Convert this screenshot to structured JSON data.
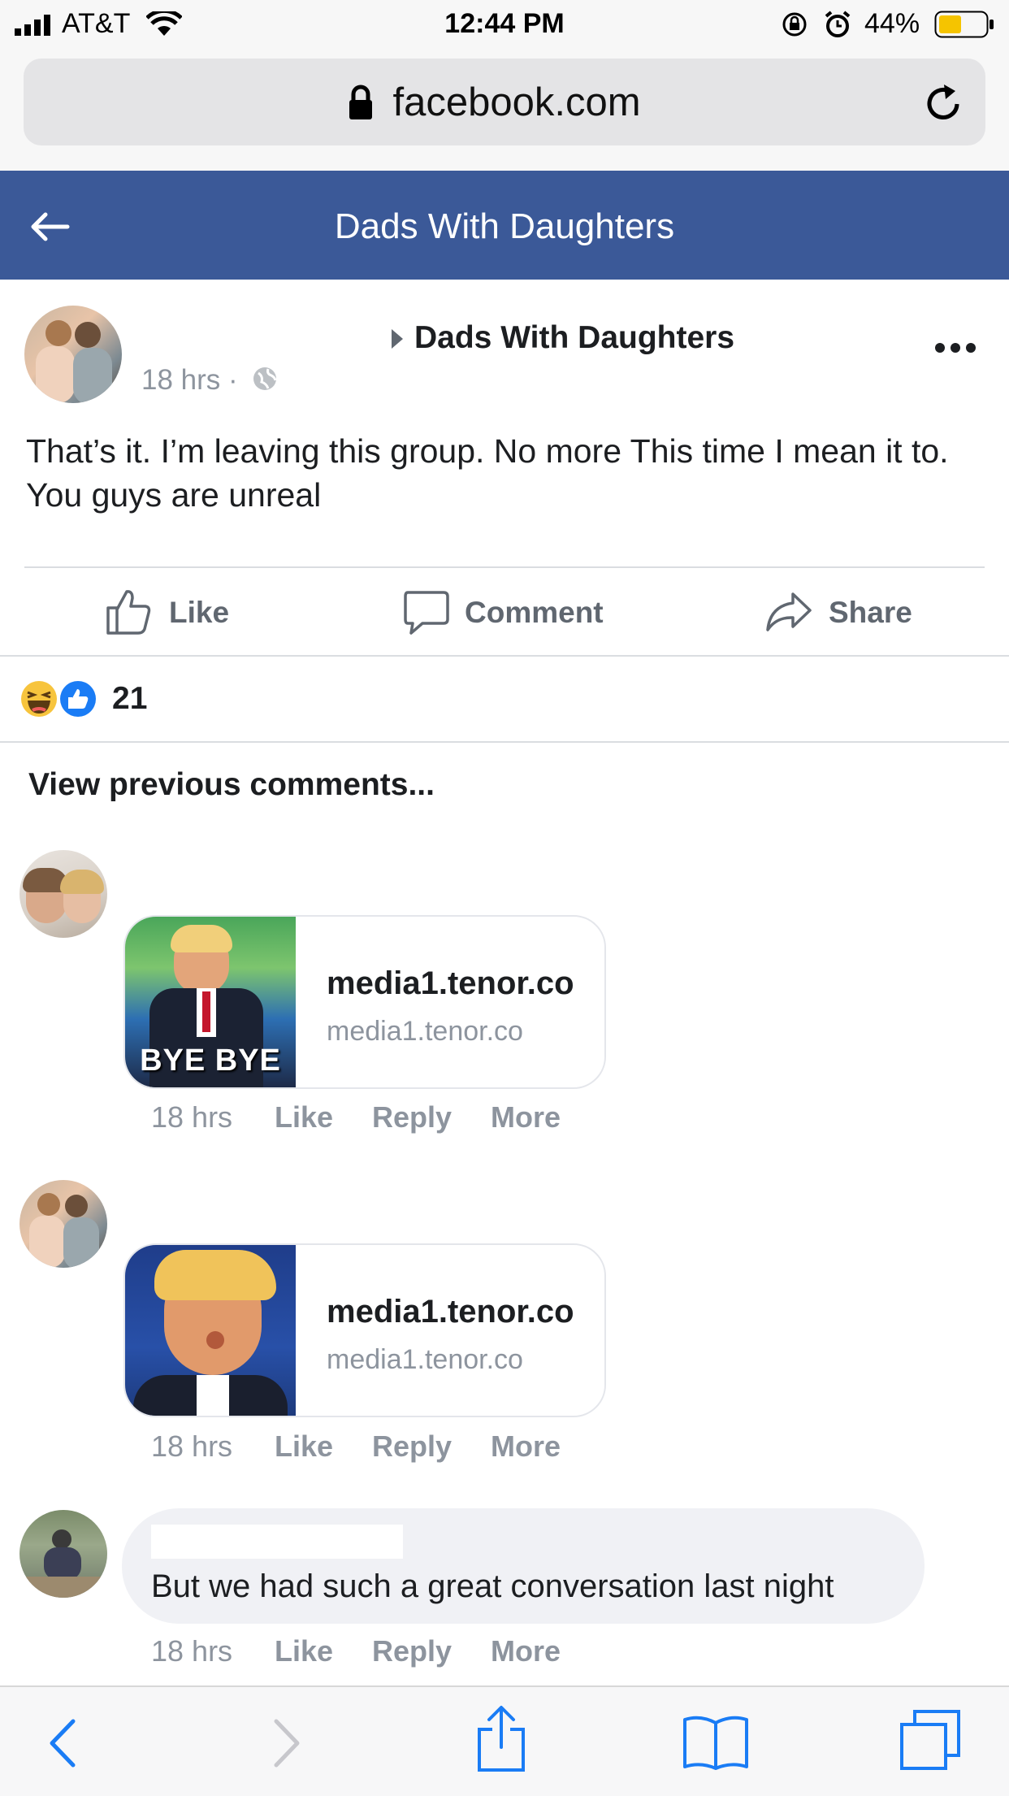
{
  "status_bar": {
    "carrier": "AT&T",
    "time": "12:44 PM",
    "battery": "44%",
    "icons": [
      "signal-icon",
      "wifi-icon",
      "rotation-lock-icon",
      "alarm-icon",
      "battery-icon"
    ]
  },
  "browser": {
    "url": "facebook.com",
    "icons": [
      "lock-icon",
      "reload-icon"
    ]
  },
  "header": {
    "title": "Dads With Daughters",
    "back_icon": "back-arrow-icon"
  },
  "post": {
    "group": "Dads With Daughters",
    "time": "18 hrs ·",
    "text": "That’s it. I’m leaving this group. No more This time I mean it to. You guys are unreal",
    "actions": {
      "like": "Like",
      "comment": "Comment",
      "share": "Share"
    },
    "reaction_count": "21"
  },
  "comments": {
    "view_previous": "View previous comments...",
    "items": [
      {
        "link_title": "media1.tenor.co",
        "link_sub": "media1.tenor.co",
        "thumb_caption": "BYE BYE",
        "time": "18 hrs",
        "like": "Like",
        "reply": "Reply",
        "more": "More"
      },
      {
        "link_title": "media1.tenor.co",
        "link_sub": "media1.tenor.co",
        "time": "18 hrs",
        "like": "Like",
        "reply": "Reply",
        "more": "More"
      },
      {
        "text": "But we had such a great conversation last night",
        "time": "18 hrs",
        "like": "Like",
        "reply": "Reply",
        "more": "More"
      }
    ]
  },
  "toolbar": {
    "icons": [
      "back-icon",
      "forward-icon",
      "share-icon",
      "bookmarks-icon",
      "tabs-icon"
    ]
  },
  "colors": {
    "fb_blue": "#3b5998",
    "meta_gray": "#8d949e",
    "action_gray": "#606770",
    "ios_blue": "#1a7cf5",
    "battery_yellow": "#f5c400"
  }
}
